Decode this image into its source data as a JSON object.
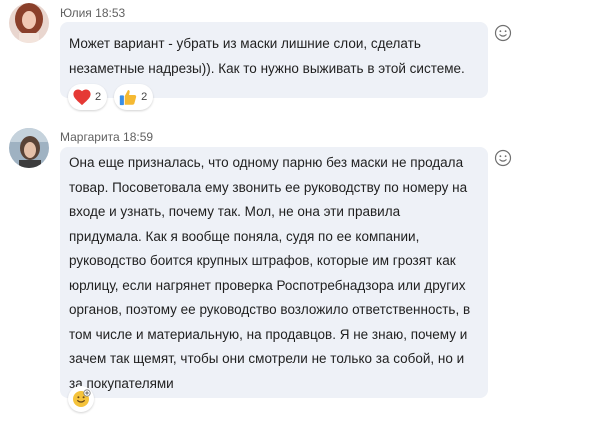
{
  "messages": [
    {
      "author": "Юлия",
      "time": "18:53",
      "text": "Может вариант - убрать из маски лишние слои, сделать незаметные надрезы)). Как то нужно выживать в этой системе.",
      "reactions": [
        {
          "icon": "heart-icon",
          "count": "2"
        },
        {
          "icon": "thumbs-up-icon",
          "count": "2"
        }
      ]
    },
    {
      "author": "Маргарита",
      "time": "18:59",
      "text": "Она еще призналась, что одному парню без маски не продала товар. Посоветовала ему звонить ее руководству по номеру на входе и узнать, почему так. Мол, не она эти правила придумала. Как я вообще поняла, судя по ее компании, руководство боится крупных штрафов, которые им грозят как юрлицу, если нагрянет проверка Роспотребнадзора или других органов, поэтому ее руководство возложило ответственность, в том числе и материальную, на продавцов. Я не знаю, почему и зачем так щемят, чтобы они смотрели не только за собой, но и за покупателями",
      "reactions": [
        {
          "icon": "add-reaction-icon",
          "count": ""
        }
      ]
    }
  ],
  "colors": {
    "bubble": "#eef1f7",
    "heart": "#e53935",
    "thumb": "#f5b932",
    "meta": "#616161"
  }
}
